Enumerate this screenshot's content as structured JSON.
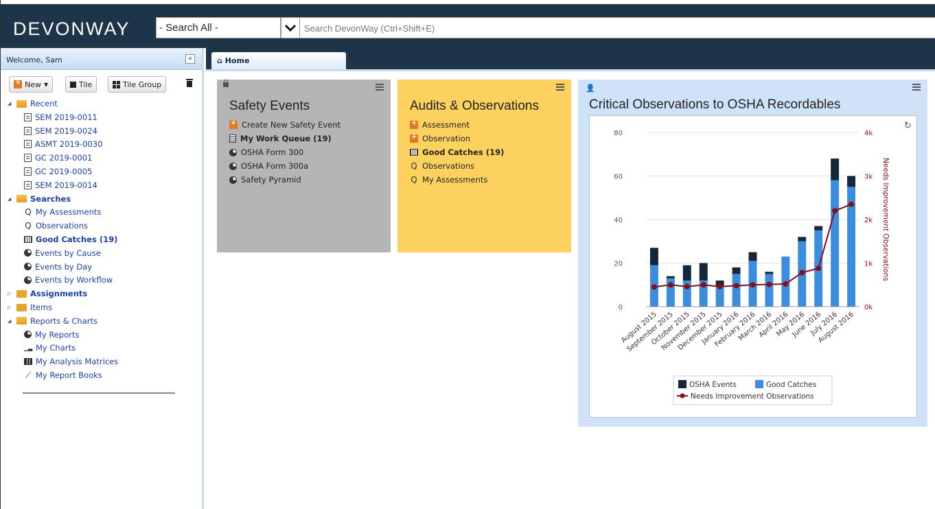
{
  "app": {
    "logo": "DEVONWAY"
  },
  "search": {
    "scope": "- Search All -",
    "placeholder": "Search DevonWay (Ctrl+Shift+E)"
  },
  "sidebar": {
    "welcome": "Welcome, Sam",
    "toolbar": {
      "new_label": "New",
      "tile_label": "Tile",
      "tile_group_label": "Tile Group"
    },
    "tree": [
      {
        "label": "Recent",
        "type": "folder-open",
        "level": 0,
        "bold": false
      },
      {
        "label": "SEM 2019-0011",
        "type": "doc",
        "level": 1
      },
      {
        "label": "SEM 2019-0024",
        "type": "doc",
        "level": 1
      },
      {
        "label": "ASMT 2019-0030",
        "type": "doc",
        "level": 1
      },
      {
        "label": "GC 2019-0001",
        "type": "doc",
        "level": 1
      },
      {
        "label": "GC 2019-0005",
        "type": "doc",
        "level": 1
      },
      {
        "label": "SEM 2019-0014",
        "type": "doc",
        "level": 1
      },
      {
        "label": "Searches",
        "type": "folder-open",
        "level": 0,
        "bold": true
      },
      {
        "label": "My Assessments",
        "type": "search",
        "level": 1
      },
      {
        "label": "Observations",
        "type": "search",
        "level": 1
      },
      {
        "label": "Good Catches (19)",
        "type": "grid",
        "level": 1,
        "bold": true
      },
      {
        "label": "Events by Cause",
        "type": "pie",
        "level": 1
      },
      {
        "label": "Events by Day",
        "type": "pie",
        "level": 1
      },
      {
        "label": "Events by Workflow",
        "type": "pie",
        "level": 1
      },
      {
        "label": "Assignments",
        "type": "folder-closed",
        "level": 0,
        "bold": true
      },
      {
        "label": "Items",
        "type": "folder-closed",
        "level": 0
      },
      {
        "label": "Reports & Charts",
        "type": "folder-open",
        "level": 0
      },
      {
        "label": "My Reports",
        "type": "pie",
        "level": 1
      },
      {
        "label": "My Charts",
        "type": "chart",
        "level": 1
      },
      {
        "label": "My Analysis Matrices",
        "type": "matrix",
        "level": 1
      },
      {
        "label": "My Report Books",
        "type": "linechart",
        "level": 1
      }
    ]
  },
  "tabs": {
    "home": "Home"
  },
  "tiles": {
    "safety": {
      "title": "Safety Events",
      "color": "#b5b5b8",
      "items": [
        {
          "label": "Create New Safety Event",
          "icon": "new-icon",
          "bold": false
        },
        {
          "label": "My Work Queue (19)",
          "icon": "clipboard-icon",
          "bold": true
        },
        {
          "label": "OSHA Form 300",
          "icon": "pie-icon",
          "bold": false
        },
        {
          "label": "OSHA Form 300a",
          "icon": "pie-icon",
          "bold": false
        },
        {
          "label": "Safety Pyramid",
          "icon": "pie-icon",
          "bold": false
        }
      ]
    },
    "audits": {
      "title": "Audits & Observations",
      "color": "#fdd15e",
      "items": [
        {
          "label": "Assessment",
          "icon": "new-icon",
          "bold": false
        },
        {
          "label": "Observation",
          "icon": "new-icon",
          "bold": false
        },
        {
          "label": "Good Catches (19)",
          "icon": "grid-icon",
          "bold": true
        },
        {
          "label": "Observations",
          "icon": "search-icon",
          "bold": false
        },
        {
          "label": "My Assessments",
          "icon": "search-icon",
          "bold": false
        }
      ]
    },
    "chart": {
      "title": "Critical Observations to OSHA Recordables",
      "color": "#cfe2f7"
    }
  },
  "chart_data": {
    "type": "bar",
    "title": "Critical Observations to OSHA Recordables",
    "categories": [
      "August 2015",
      "September 2015",
      "October 2015",
      "November 2015",
      "December 2015",
      "January 2016",
      "February 2016",
      "March 2016",
      "April 2016",
      "May 2016",
      "June 2016",
      "July 2016",
      "August 2016"
    ],
    "series": [
      {
        "name": "OSHA Events",
        "kind": "stacked-bar",
        "axis": "left",
        "color": "#15273a",
        "values": [
          8,
          1,
          7,
          8,
          3,
          3,
          4,
          1,
          0,
          2,
          2,
          10,
          5
        ]
      },
      {
        "name": "Good Catches",
        "kind": "stacked-bar",
        "axis": "left",
        "color": "#3b8de0",
        "values": [
          19,
          13,
          12,
          12,
          9,
          15,
          21,
          15,
          23,
          30,
          35,
          58,
          55
        ]
      },
      {
        "name": "Needs Improvement Observations",
        "kind": "line",
        "axis": "right",
        "color": "#8b0d14",
        "values": [
          450,
          500,
          460,
          500,
          460,
          480,
          500,
          510,
          520,
          780,
          880,
          2200,
          2350
        ]
      }
    ],
    "ylim": [
      0,
      80
    ],
    "y_ticks": [
      "0",
      "20",
      "40",
      "60",
      "80"
    ],
    "y2lim": [
      0,
      4000
    ],
    "y2_ticks": [
      "0k",
      "1k",
      "2k",
      "3k",
      "4k"
    ],
    "ylabel": "",
    "y2label": "Needs Improvement Observations",
    "grid": true,
    "legend": "bottom"
  }
}
